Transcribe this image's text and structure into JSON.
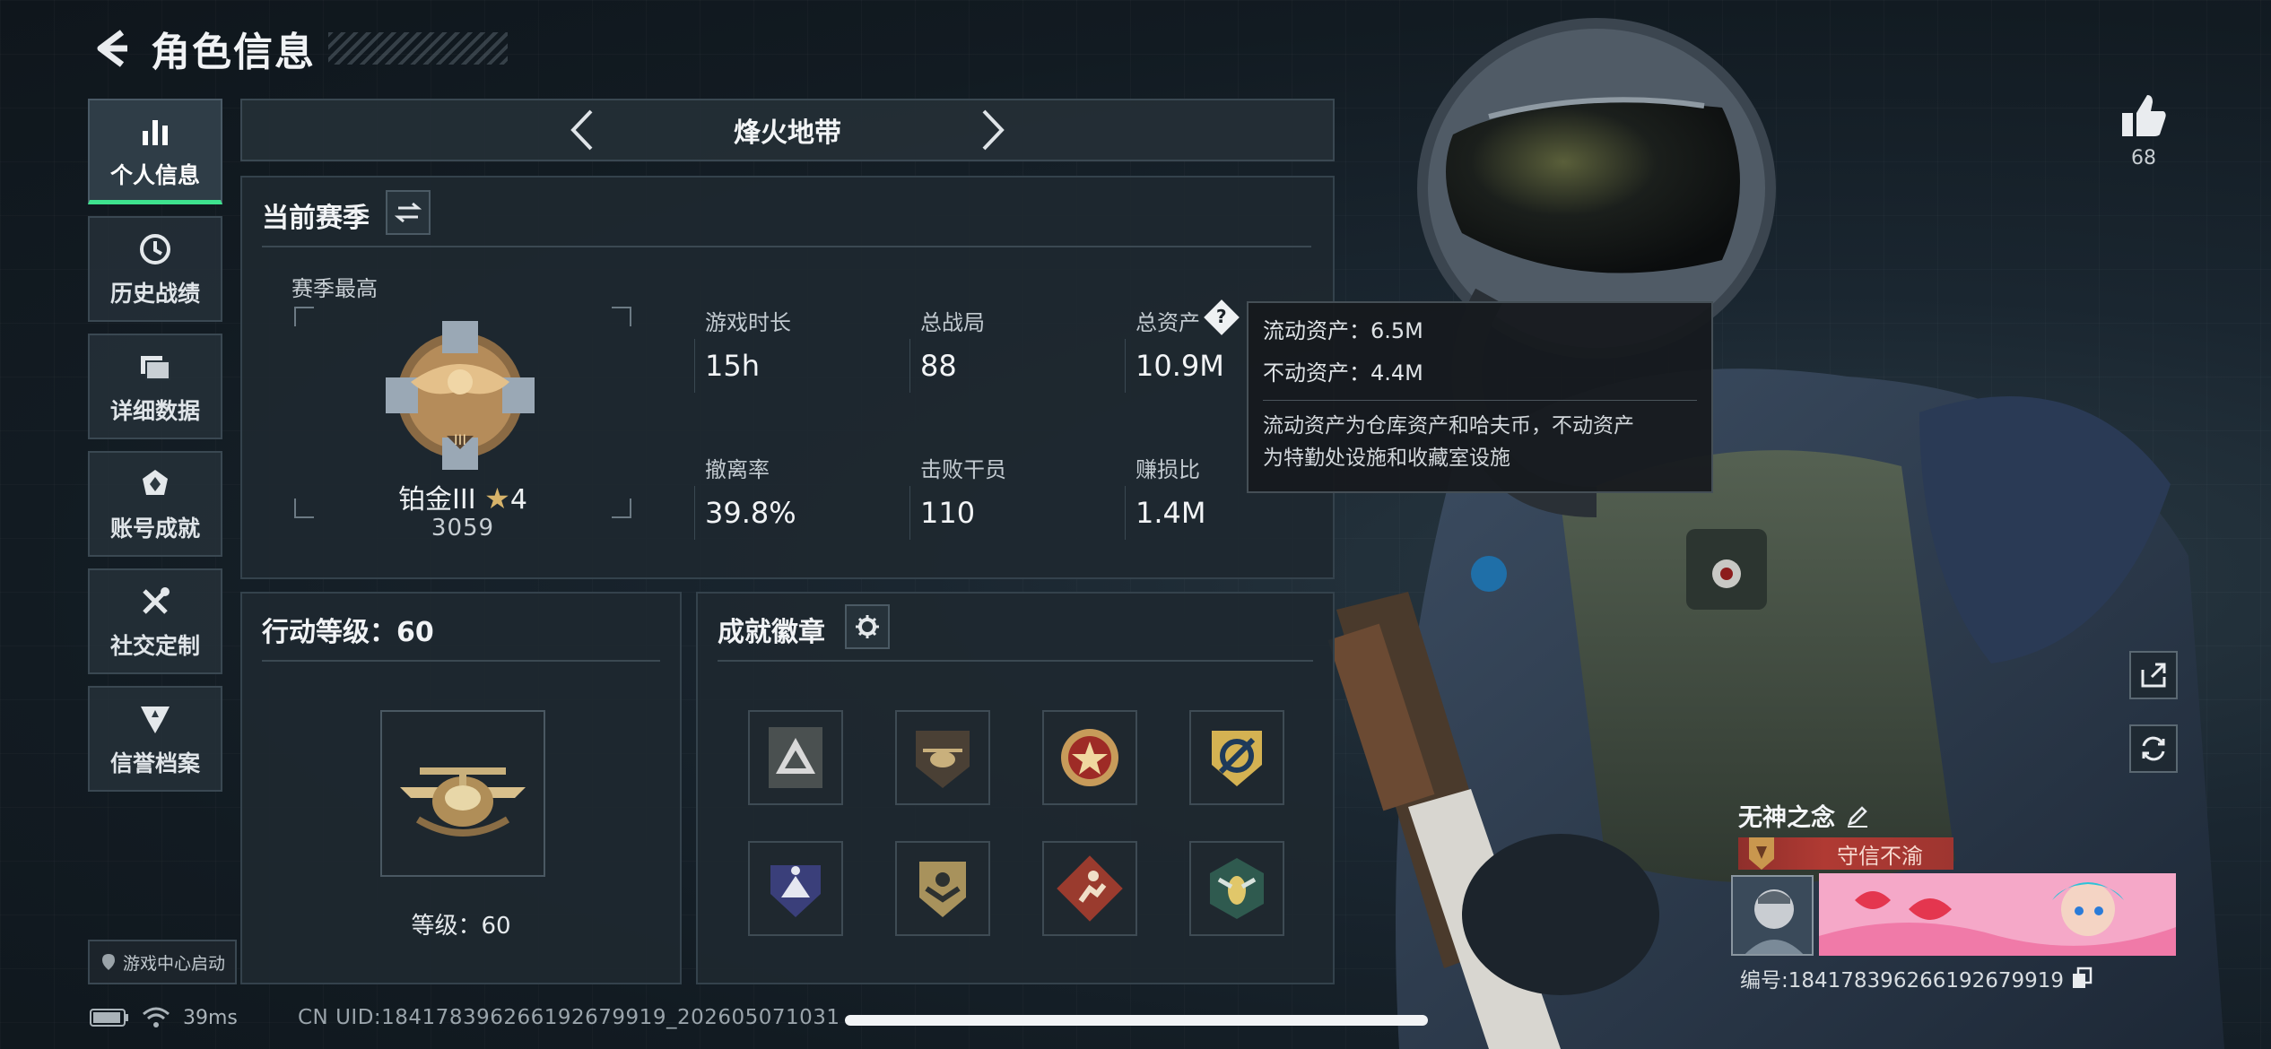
{
  "header": {
    "title": "角色信息"
  },
  "sidebar": {
    "items": [
      {
        "label": "个人信息",
        "icon": "bar-chart-icon",
        "active": true
      },
      {
        "label": "历史战绩",
        "icon": "clock-icon"
      },
      {
        "label": "详细数据",
        "icon": "folder-icon"
      },
      {
        "label": "账号成就",
        "icon": "medal-icon"
      },
      {
        "label": "社交定制",
        "icon": "tools-icon"
      },
      {
        "label": "信誉档案",
        "icon": "shield-badge-icon"
      }
    ],
    "launch_label": "游戏中心启动"
  },
  "mode": {
    "name": "烽火地带"
  },
  "season": {
    "title": "当前赛季",
    "best_label": "赛季最高",
    "rank_name": "铂金III",
    "rank_stars": "4",
    "rank_score": "3059",
    "stats": [
      {
        "label": "游戏时长",
        "value": "15h"
      },
      {
        "label": "总战局",
        "value": "88"
      },
      {
        "label": "总资产",
        "value": "10.9M"
      },
      {
        "label": "撤离率",
        "value": "39.8%"
      },
      {
        "label": "击败干员",
        "value": "110"
      },
      {
        "label": "赚损比",
        "value": "1.4M"
      }
    ]
  },
  "tooltip": {
    "liquid": "流动资产：6.5M",
    "fixed": "不动资产：4.4M",
    "note_1": "流动资产为仓库资产和哈夫币，不动资产",
    "note_2": "为特勤处设施和收藏室设施"
  },
  "action_level": {
    "title": "行动等级：60",
    "level_text": "等级：60"
  },
  "badges": {
    "title": "成就徽章"
  },
  "like": {
    "count": "68"
  },
  "player": {
    "name": "无神之念",
    "title_tag": "守信不渝",
    "id_text": "编号:18417839626619267991​9"
  },
  "status": {
    "ping": "39ms",
    "uid": "CN UID:18417839626619267991​9_202605071031"
  },
  "colors": {
    "accent": "#3ee28e",
    "panel": "#1e2830",
    "tag": "#b03a33"
  }
}
